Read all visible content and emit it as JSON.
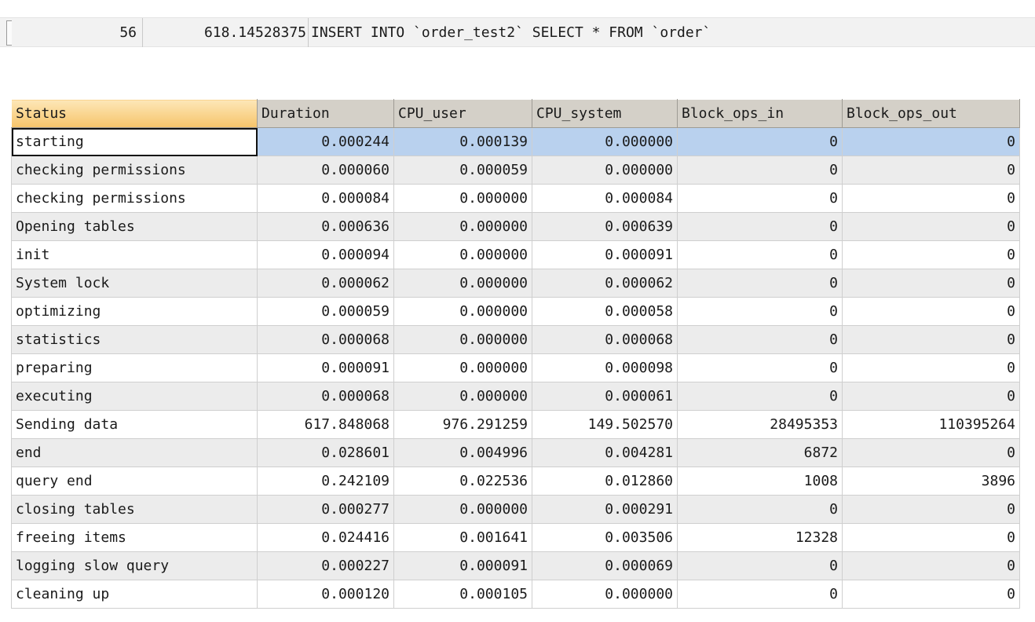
{
  "query": {
    "id": "56",
    "duration": "618.14528375",
    "sql": "INSERT INTO `order_test2` SELECT * FROM `order`"
  },
  "profile": {
    "columns": [
      "Status",
      "Duration",
      "CPU_user",
      "CPU_system",
      "Block_ops_in",
      "Block_ops_out"
    ],
    "rows": [
      [
        "starting",
        "0.000244",
        "0.000139",
        "0.000000",
        "0",
        "0"
      ],
      [
        "checking permissions",
        "0.000060",
        "0.000059",
        "0.000000",
        "0",
        "0"
      ],
      [
        "checking permissions",
        "0.000084",
        "0.000000",
        "0.000084",
        "0",
        "0"
      ],
      [
        "Opening tables",
        "0.000636",
        "0.000000",
        "0.000639",
        "0",
        "0"
      ],
      [
        "init",
        "0.000094",
        "0.000000",
        "0.000091",
        "0",
        "0"
      ],
      [
        "System lock",
        "0.000062",
        "0.000000",
        "0.000062",
        "0",
        "0"
      ],
      [
        "optimizing",
        "0.000059",
        "0.000000",
        "0.000058",
        "0",
        "0"
      ],
      [
        "statistics",
        "0.000068",
        "0.000000",
        "0.000068",
        "0",
        "0"
      ],
      [
        "preparing",
        "0.000091",
        "0.000000",
        "0.000098",
        "0",
        "0"
      ],
      [
        "executing",
        "0.000068",
        "0.000000",
        "0.000061",
        "0",
        "0"
      ],
      [
        "Sending data",
        "617.848068",
        "976.291259",
        "149.502570",
        "28495353",
        "110395264"
      ],
      [
        "end",
        "0.028601",
        "0.004996",
        "0.004281",
        "6872",
        "0"
      ],
      [
        "query end",
        "0.242109",
        "0.022536",
        "0.012860",
        "1008",
        "3896"
      ],
      [
        "closing tables",
        "0.000277",
        "0.000000",
        "0.000291",
        "0",
        "0"
      ],
      [
        "freeing items",
        "0.024416",
        "0.001641",
        "0.003506",
        "12328",
        "0"
      ],
      [
        "logging slow query",
        "0.000227",
        "0.000091",
        "0.000069",
        "0",
        "0"
      ],
      [
        "cleaning up",
        "0.000120",
        "0.000105",
        "0.000000",
        "0",
        "0"
      ]
    ]
  },
  "colors": {
    "header_bg": "#d4d0c8",
    "sorted_header": "#f6c46a",
    "selected_row": "#b9d1ee",
    "alt_row": "#ececec"
  }
}
